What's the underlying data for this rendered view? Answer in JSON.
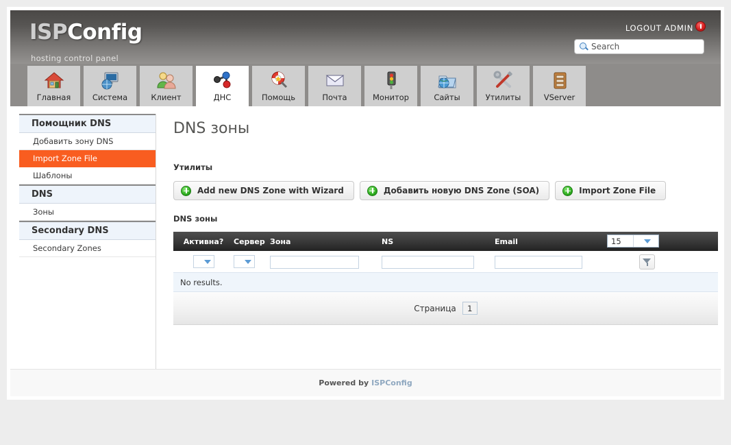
{
  "header": {
    "logo_prefix": "ISP",
    "logo_suffix": "Config",
    "tagline": "hosting control panel",
    "logout_label": "LOGOUT ADMIN",
    "power_icon": "power-icon",
    "search_placeholder": "Search",
    "search_value": "",
    "search_icon": "search-icon"
  },
  "tabs": [
    {
      "label": "Главная",
      "icon": "home-icon",
      "active": false
    },
    {
      "label": "Система",
      "icon": "system-icon",
      "active": false
    },
    {
      "label": "Клиент",
      "icon": "client-icon",
      "active": false
    },
    {
      "label": "ДНС",
      "icon": "dns-icon",
      "active": true
    },
    {
      "label": "Помощь",
      "icon": "help-icon",
      "active": false
    },
    {
      "label": "Почта",
      "icon": "mail-icon",
      "active": false
    },
    {
      "label": "Монитор",
      "icon": "monitor-icon",
      "active": false
    },
    {
      "label": "Сайты",
      "icon": "sites-icon",
      "active": false
    },
    {
      "label": "Утилиты",
      "icon": "tools-icon",
      "active": false
    },
    {
      "label": "VServer",
      "icon": "vserver-icon",
      "active": false
    }
  ],
  "sidebar": {
    "sections": [
      {
        "header": "Помощник DNS",
        "items": [
          {
            "label": "Добавить зону DNS",
            "active": false
          },
          {
            "label": "Import Zone File",
            "active": true
          },
          {
            "label": "Шаблоны",
            "active": false
          }
        ]
      },
      {
        "header": "DNS",
        "items": [
          {
            "label": "Зоны",
            "active": false
          }
        ]
      },
      {
        "header": "Secondary DNS",
        "items": [
          {
            "label": "Secondary Zones",
            "active": false
          }
        ]
      }
    ]
  },
  "main": {
    "page_title": "DNS зоны",
    "utilities_label": "Утилиты",
    "buttons": [
      {
        "label": "Add new DNS Zone with Wizard",
        "icon": "plus-icon"
      },
      {
        "label": "Добавить новую DNS Zone (SOA)",
        "icon": "plus-icon"
      },
      {
        "label": "Import Zone File",
        "icon": "plus-icon"
      }
    ],
    "table_label": "DNS зоны",
    "table": {
      "columns": [
        "Активна?",
        "Сервер",
        "Зона",
        "NS",
        "Email"
      ],
      "per_page_value": "15",
      "filters": {
        "active_value": "",
        "server_value": "",
        "zone_value": "",
        "ns_value": "",
        "email_value": ""
      },
      "filter_button_icon": "funnel-icon",
      "empty_message": "No results.",
      "rows": []
    },
    "pagination": {
      "label": "Страница",
      "current_page": "1"
    }
  },
  "footer": {
    "powered_by": "Powered by",
    "brand": "ISPConfig"
  },
  "colors": {
    "accent_orange": "#f95d20",
    "header_dark": "#4a4846",
    "table_header": "#3c3c3c",
    "tab_bar": "#8e8c8a",
    "brand_blue": "#8fa8c0"
  }
}
